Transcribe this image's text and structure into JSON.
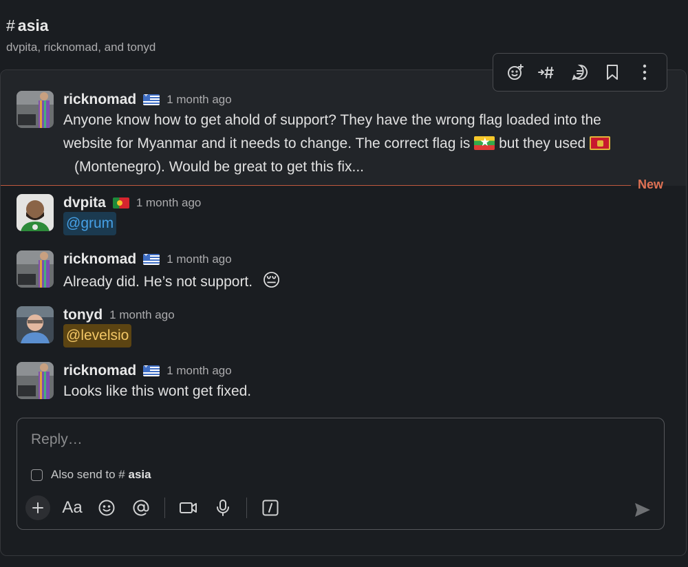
{
  "channel": {
    "hash": "#",
    "name": "asia",
    "members": "dvpita, ricknomad, and tonyd"
  },
  "toolbar": {
    "icons": [
      "add-reaction-icon",
      "forward-to-channel-icon",
      "reply-in-thread-icon",
      "bookmark-icon",
      "more-actions-icon"
    ]
  },
  "messages": [
    {
      "author": "ricknomad",
      "flag": "greece-flag",
      "time": "1 month ago",
      "line1": "Anyone know how to get ahold of support? They have the wrong flag loaded into the",
      "line2a": "website for Myanmar and it needs to change.  The correct flag is",
      "line2b": "but they used",
      "line3": "(Montenegro). Would be great to get this fix..."
    },
    {
      "author": "dvpita",
      "flag": "portugal-flag",
      "time": "1 month ago",
      "mention": "@grum"
    },
    {
      "author": "ricknomad",
      "flag": "greece-flag",
      "time": "1 month ago",
      "text": "Already did.  He’s not support.",
      "emoji": "😔"
    },
    {
      "author": "tonyd",
      "time": "1 month ago",
      "mention": "@levelsio"
    },
    {
      "author": "ricknomad",
      "flag": "greece-flag",
      "time": "1 month ago",
      "text": "Looks like this wont get fixed."
    }
  ],
  "divider": {
    "label": "New"
  },
  "composer": {
    "placeholder": "Reply…",
    "also_send_prefix": "Also send to",
    "also_send_hash": "#",
    "also_send_channel": "asia",
    "format_label": "Aa",
    "tools": [
      "plus-icon",
      "format-text-icon",
      "emoji-icon",
      "mention-icon",
      "video-icon",
      "microphone-icon",
      "slash-command-icon"
    ],
    "send_icon": "send-icon"
  },
  "colors": {
    "background": "#1a1d21",
    "new_divider": "#e07254",
    "mention_blue": "#46a0e6",
    "mention_yellow": "#f3c766"
  }
}
